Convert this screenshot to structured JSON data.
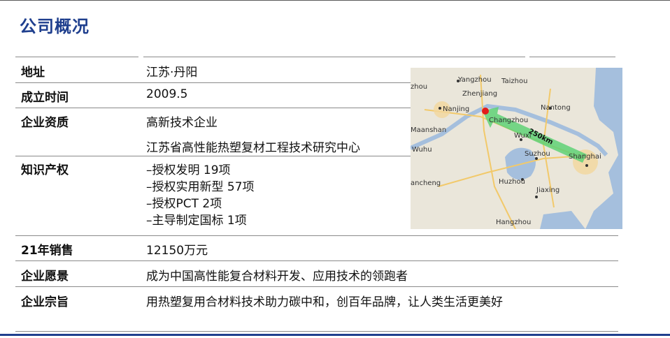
{
  "page": {
    "title": "公司概况"
  },
  "table": {
    "rows": [
      {
        "label": "地址",
        "values": [
          "江苏·丹阳"
        ]
      },
      {
        "label": "成立时间",
        "values": [
          "2009.5"
        ]
      },
      {
        "label": "企业资质",
        "values": [
          "高新技术企业",
          "江苏省高性能热塑复材工程技术研究中心"
        ]
      },
      {
        "label": "知识产权",
        "values": [
          "–授权发明 19项",
          "–授权实用新型 57项",
          "–授权PCT 2项",
          "–主导制定国标 1项"
        ]
      },
      {
        "label": "21年销售",
        "values": [
          "12150万元"
        ]
      },
      {
        "label": "企业愿景",
        "values": [
          "成为中国高性能复合材料开发、应用技术的领跑者"
        ]
      },
      {
        "label": "企业宗旨",
        "values": [
          "用热塑复用合材料技术助力碳中和，创百年品牌，让人类生活更美好"
        ]
      }
    ]
  },
  "map": {
    "cities": [
      "Yangzhou",
      "Taizhou",
      "zhou",
      "Zhenjiang",
      "Nanjing",
      "Changzhou",
      "Nantong",
      "Maanshan",
      "Wuxi",
      "Wuhu",
      "Suzhou",
      "Shanghai",
      "ancheng",
      "Huzhou",
      "Jiaxing",
      "Hangzhou"
    ],
    "distance_label": "250km"
  }
}
